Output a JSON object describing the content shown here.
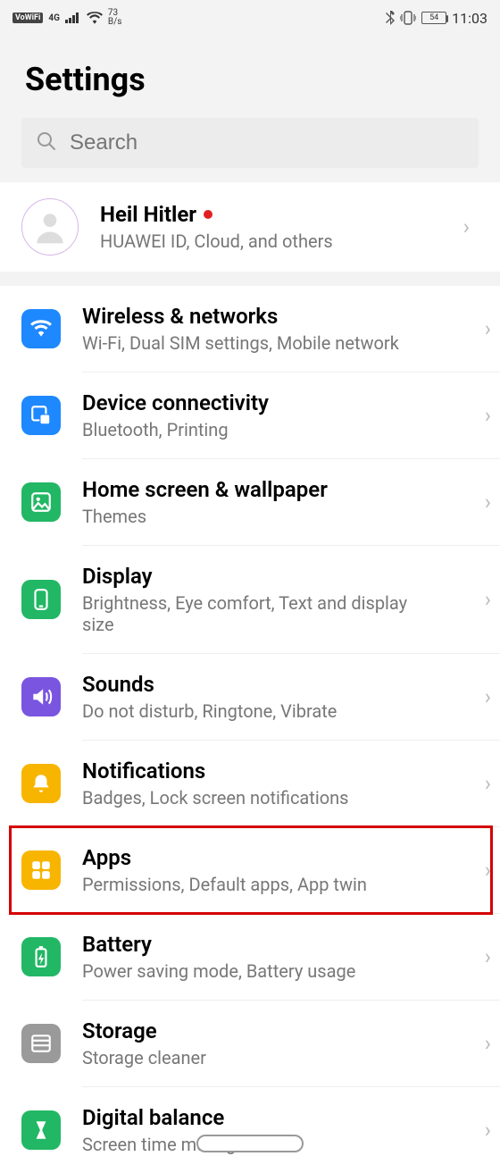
{
  "status": {
    "vowifi": "VoWiFi",
    "net_gen": "4G",
    "data_rate_top": "73",
    "data_rate_bottom": "B/s",
    "battery_text": "54",
    "time": "11:03"
  },
  "header": {
    "title": "Settings"
  },
  "search": {
    "placeholder": "Search"
  },
  "account": {
    "name": "Heil Hitler",
    "subtitle": "HUAWEI ID, Cloud, and others"
  },
  "items": [
    {
      "id": "wireless",
      "title": "Wireless & networks",
      "subtitle": "Wi-Fi, Dual SIM settings, Mobile network",
      "color": "#1e88ff"
    },
    {
      "id": "device-conn",
      "title": "Device connectivity",
      "subtitle": "Bluetooth, Printing",
      "color": "#1e88ff"
    },
    {
      "id": "home-wall",
      "title": "Home screen & wallpaper",
      "subtitle": "Themes",
      "color": "#22b765"
    },
    {
      "id": "display",
      "title": "Display",
      "subtitle": "Brightness, Eye comfort, Text and display size",
      "color": "#22b765"
    },
    {
      "id": "sounds",
      "title": "Sounds",
      "subtitle": "Do not disturb, Ringtone, Vibrate",
      "color": "#7a55e0"
    },
    {
      "id": "notifs",
      "title": "Notifications",
      "subtitle": "Badges, Lock screen notifications",
      "color": "#f7b500"
    },
    {
      "id": "apps",
      "title": "Apps",
      "subtitle": "Permissions, Default apps, App twin",
      "color": "#f7b500",
      "highlighted": true
    },
    {
      "id": "battery",
      "title": "Battery",
      "subtitle": "Power saving mode, Battery usage",
      "color": "#22b765"
    },
    {
      "id": "storage",
      "title": "Storage",
      "subtitle": "Storage cleaner",
      "color": "#9a9a9a"
    },
    {
      "id": "digital",
      "title": "Digital balance",
      "subtitle": "Screen time management",
      "color": "#22b765"
    }
  ]
}
